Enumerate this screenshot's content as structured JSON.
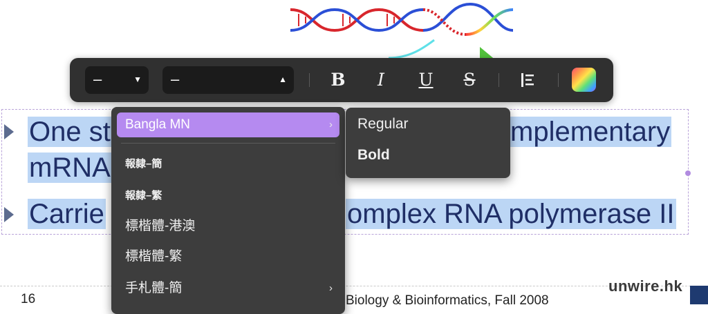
{
  "slide": {
    "line1_start": "One st",
    "line1_end": "mplementary",
    "line2": "mRNA",
    "line3_start": "Carrie",
    "line3_end": "omplex RNA polymerase II",
    "page_number": "16",
    "footer": "Biology & Bioinformatics, Fall 2008",
    "watermark": "unwire.hk"
  },
  "toolbar": {
    "size_value": "–",
    "font_value": "–",
    "bold_label": "B",
    "italic_label": "I",
    "underline_label": "U",
    "strike_label": "S"
  },
  "font_menu": {
    "items": [
      {
        "label": "Bangla MN",
        "has_submenu": true,
        "active": true
      },
      {
        "label": "報隸–簡",
        "has_submenu": false
      },
      {
        "label": "報隸–繁",
        "has_submenu": false
      },
      {
        "label": "標楷體-港澳",
        "has_submenu": false
      },
      {
        "label": "標楷體-繁",
        "has_submenu": false
      },
      {
        "label": "手札體-簡",
        "has_submenu": true
      }
    ],
    "chevron": "›"
  },
  "font_submenu": {
    "items": [
      "Regular",
      "Bold"
    ]
  },
  "colors": {
    "toolbar_bg": "#303030",
    "menu_bg": "#3d3d3d",
    "highlight": "#b58af0",
    "text_selection": "#bcd6f5",
    "slide_text": "#1f2e66"
  }
}
